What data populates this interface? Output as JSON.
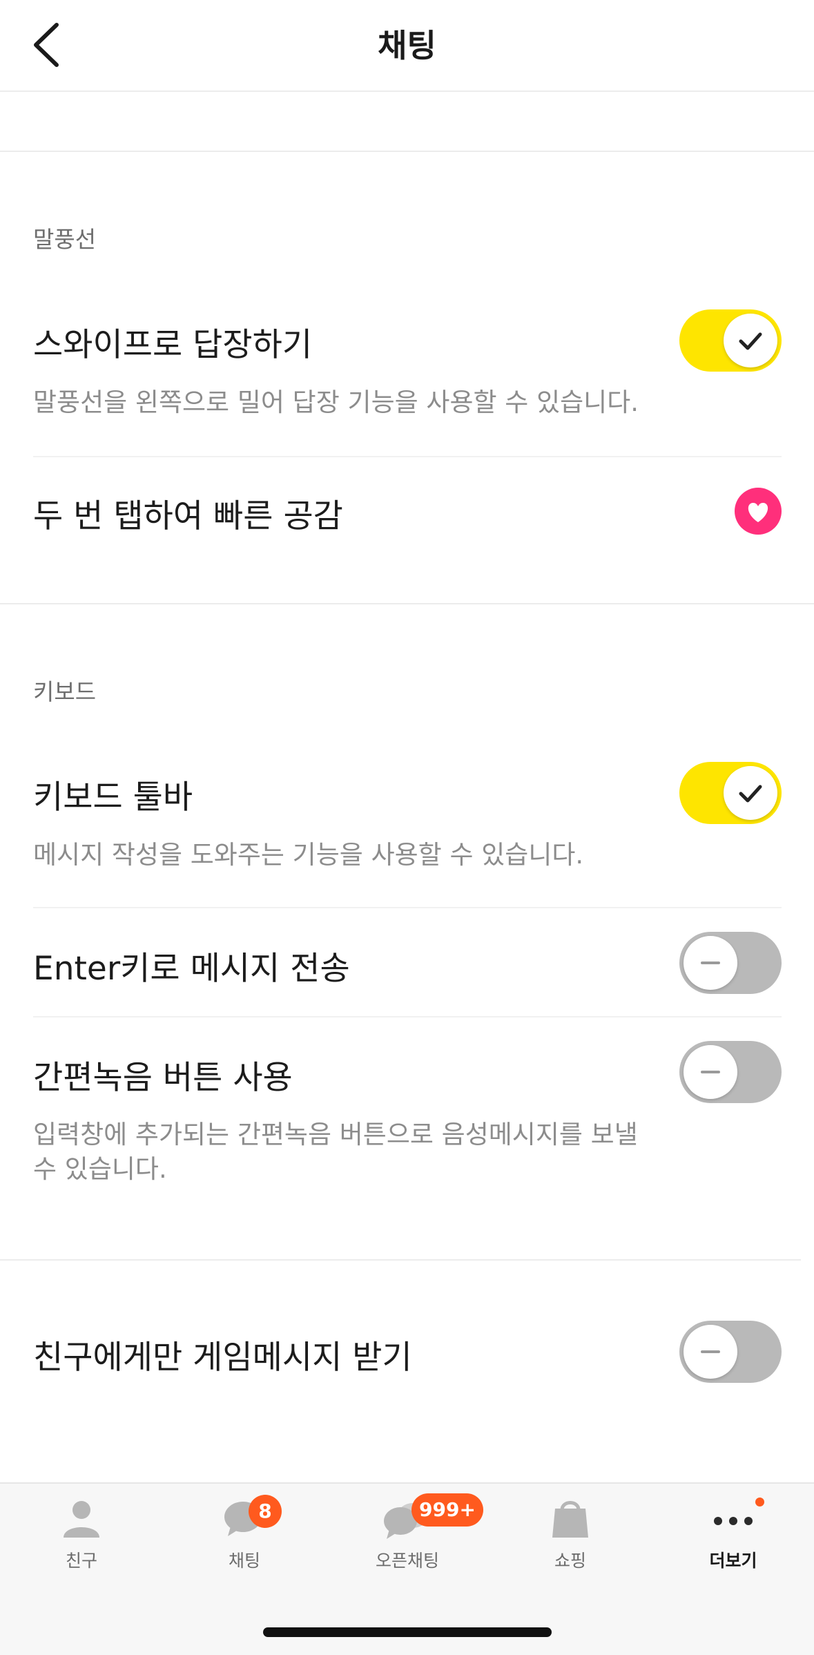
{
  "header": {
    "title": "채팅"
  },
  "sections": {
    "bubble": {
      "title": "말풍선",
      "swipe_reply": {
        "label": "스와이프로 답장하기",
        "description": "말풍선을 왼쪽으로 밀어 답장 기능을 사용할 수 있습니다.",
        "enabled": true
      },
      "double_tap": {
        "label": "두 번 탭하여 빠른 공감",
        "icon": "heart-icon",
        "color": "#ff2f7b"
      }
    },
    "keyboard": {
      "title": "키보드",
      "toolbar": {
        "label": "키보드 툴바",
        "description": "메시지 작성을 도와주는 기능을 사용할 수 있습니다.",
        "enabled": true
      },
      "enter_send": {
        "label": "Enter키로 메시지 전송",
        "enabled": false
      },
      "voice_button": {
        "label": "간편녹음 버튼 사용",
        "description_line1": "입력창에 추가되는 간편녹음 버튼으로 음성메시지를 보낼",
        "description_line2": "수 있습니다.",
        "enabled": false
      }
    },
    "game": {
      "label": "친구에게만 게임메시지 받기",
      "enabled": false
    }
  },
  "tabs": [
    {
      "label": "친구",
      "icon": "person-icon",
      "active": false
    },
    {
      "label": "채팅",
      "icon": "chat-bubble-icon",
      "badge": "8",
      "active": false
    },
    {
      "label": "오픈채팅",
      "icon": "open-chat-icon",
      "badge": "999+",
      "active": false
    },
    {
      "label": "쇼핑",
      "icon": "shopping-bag-icon",
      "active": false
    },
    {
      "label": "더보기",
      "icon": "more-dots-icon",
      "active": true
    }
  ],
  "colors": {
    "accent_yellow": "#fee500",
    "toggle_off": "#b9b9b9",
    "badge": "#ff5a1e",
    "heart": "#ff2f7b"
  }
}
